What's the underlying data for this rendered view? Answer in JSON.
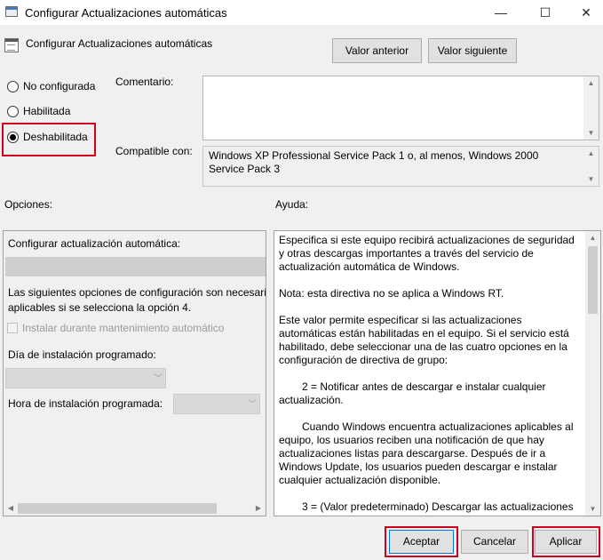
{
  "window": {
    "title": "Configurar Actualizaciones automáticas",
    "minimize_glyph": "—",
    "maximize_glyph": "☐",
    "close_glyph": "✕"
  },
  "header": {
    "policy_name": "Configurar Actualizaciones automáticas",
    "prev_button": "Valor anterior",
    "next_button": "Valor siguiente"
  },
  "state_options": [
    {
      "label": "No configurada",
      "checked": false
    },
    {
      "label": "Habilitada",
      "checked": false
    },
    {
      "label": "Deshabilitada",
      "checked": true
    }
  ],
  "comment": {
    "label": "Comentario:",
    "value": ""
  },
  "compatible": {
    "label": "Compatible con:",
    "value": "Windows XP Professional Service Pack 1 o, al menos, Windows 2000 Service Pack 3"
  },
  "options_panel": {
    "title": "Opciones:",
    "configure_label": "Configurar actualización automática:",
    "desc_line1": "Las siguientes opciones de configuración son necesaria",
    "desc_line2": "aplicables si se selecciona la opción 4.",
    "install_maintenance_label": "Instalar durante mantenimiento automático",
    "install_day_label": "Día de instalación programado:",
    "install_hour_label": "Hora de instalación programada:"
  },
  "help_panel": {
    "title": "Ayuda:",
    "paragraphs": [
      "Especifica si este equipo recibirá actualizaciones de seguridad y otras descargas importantes a través del servicio de actualización automática de Windows.",
      "Nota: esta directiva no se aplica a Windows RT.",
      "Este valor permite especificar si las actualizaciones automáticas están habilitadas en el equipo. Si el servicio está habilitado, debe seleccionar una de las cuatro opciones en la configuración de directiva de grupo:",
      "2 = Notificar antes de descargar e instalar cualquier actualización.",
      "Cuando Windows encuentra actualizaciones aplicables al equipo, los usuarios reciben una notificación de que hay actualizaciones listas para descargarse. Después de ir a Windows Update, los usuarios pueden descargar e instalar cualquier actualización disponible.",
      "3 = (Valor predeterminado) Descargar las actualizaciones"
    ]
  },
  "footer": {
    "ok": "Aceptar",
    "cancel": "Cancelar",
    "apply": "Aplicar"
  },
  "colors": {
    "highlight": "#d0021b",
    "window_bg": "#f0f0f0",
    "focus_border": "#0078d7"
  }
}
